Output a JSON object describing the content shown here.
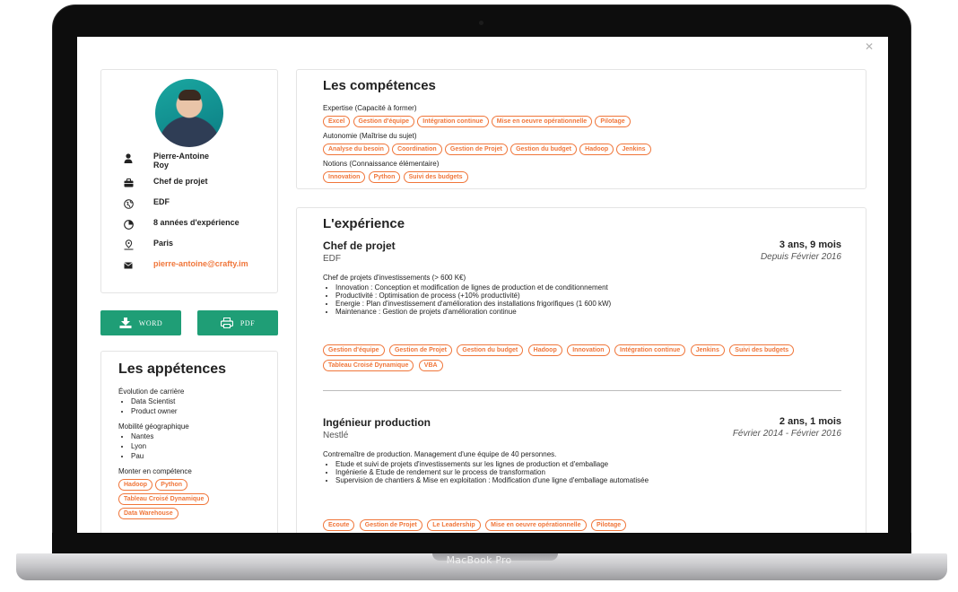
{
  "device": {
    "label": "MacBook Pro"
  },
  "profile": {
    "name": "Pierre-Antoine\nRoy",
    "position": "Chef de projet",
    "company": "EDF",
    "experience": "8 années d'expérience",
    "city": "Paris",
    "email": "pierre-antoine@crafty.im"
  },
  "buttons": {
    "word": "WORD",
    "pdf": "PDF"
  },
  "appetences": {
    "title": "Les appétences",
    "career_label": "Évolution de carrière",
    "career": [
      "Data Scientist",
      "Product owner"
    ],
    "mobility_label": "Mobilité géographique",
    "mobility": [
      "Nantes",
      "Lyon",
      "Pau"
    ],
    "upskill_label": "Monter en compétence",
    "upskill_tags": [
      "Hadoop",
      "Python",
      "Tableau Croisé Dynamique",
      "Data Warehouse"
    ]
  },
  "skills": {
    "title": "Les compétences",
    "levels": [
      {
        "label": "Expertise (Capacité à former)",
        "tags": [
          "Excel",
          "Gestion d'équipe",
          "Intégration continue",
          "Mise en oeuvre opérationnelle",
          "Pilotage"
        ]
      },
      {
        "label": "Autonomie (Maîtrise du sujet)",
        "tags": [
          "Analyse du besoin",
          "Coordination",
          "Gestion de Projet",
          "Gestion du budget",
          "Hadoop",
          "Jenkins"
        ]
      },
      {
        "label": "Notions (Connaissance élémentaire)",
        "tags": [
          "Innovation",
          "Python",
          "Suivi des budgets"
        ]
      }
    ]
  },
  "experience": {
    "title": "L'expérience",
    "jobs": [
      {
        "role": "Chef de projet",
        "company": "EDF",
        "duration": "3 ans, 9 mois",
        "period": "Depuis Février 2016",
        "intro": "Chef de projets d'investissements (> 600 K€)",
        "bullets": [
          "Innovation : Conception et modification de lignes de production et de conditionnement",
          "Productivité : Optimisation de process (+10% productivité)",
          "Energie : Plan d'investissement d'amélioration des installations frigorifiques (1 600 kW)",
          "Maintenance : Gestion de projets d'amélioration continue"
        ],
        "tags": [
          "Gestion d'équipe",
          "Gestion de Projet",
          "Gestion du budget",
          "Hadoop",
          "Innovation",
          "Intégration continue",
          "Jenkins",
          "Suivi des budgets",
          "Tableau Croisé Dynamique",
          "VBA"
        ]
      },
      {
        "role": "Ingénieur production",
        "company": "Nestlé",
        "duration": "2 ans, 1 mois",
        "period": "Février 2014 - Février 2016",
        "intro": "Contremaître de production. Management d'une équipe de 40 personnes.",
        "bullets": [
          "Etude et suivi de projets d'investissements sur les lignes de production et d'emballage",
          "Ingénierie & Etude de rendement sur le process de transformation",
          "Supervision de chantiers & Mise en exploitation : Modification d'une ligne d'emballage automatisée"
        ],
        "tags": [
          "Ecoute",
          "Gestion de Projet",
          "Le Leadership",
          "Mise en oeuvre opérationnelle",
          "Pilotage"
        ]
      }
    ]
  },
  "icons": {
    "close": "close-icon",
    "user": "user-icon",
    "briefcase": "briefcase-icon",
    "company": "globe-icon",
    "experience": "clock-icon",
    "location": "location-pin-icon",
    "email": "envelope-icon",
    "download": "download-icon",
    "print": "printer-icon"
  },
  "colors": {
    "accent": "#f0763a",
    "button": "#1f9e76",
    "text": "#222222"
  }
}
